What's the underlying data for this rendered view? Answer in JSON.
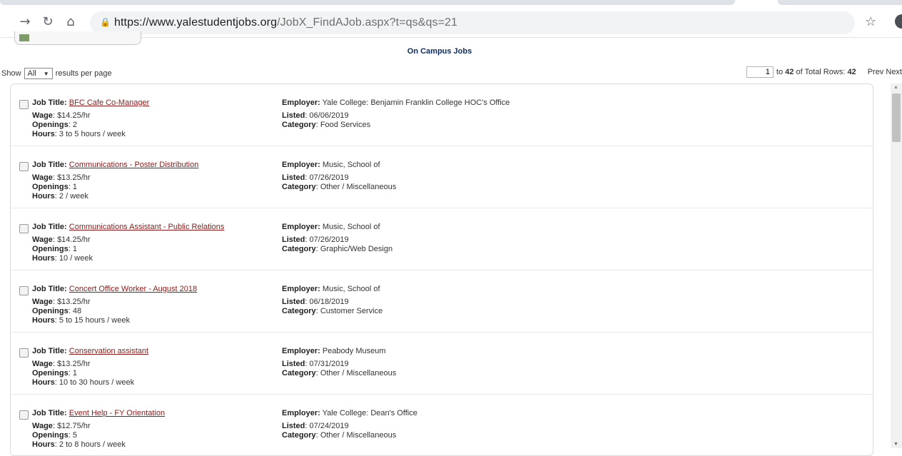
{
  "browser": {
    "url_host": "https://www.yalestudentjobs.org",
    "url_path": "/JobX_FindAJob.aspx?t=qs&qs=21"
  },
  "page": {
    "title": "On Campus Jobs",
    "show_label": "Show",
    "per_page_value": "All",
    "per_page_suffix": "results per page",
    "pager": {
      "current_page": "1",
      "to_label": "to",
      "range_end": "42",
      "of_total_label": "of Total Rows:",
      "total_rows": "42",
      "prev": "Prev",
      "next": "Next"
    }
  },
  "labels": {
    "job_title": "Job Title:",
    "wage": "Wage",
    "openings": "Openings",
    "hours": "Hours",
    "employer": "Employer:",
    "listed": "Listed",
    "category": "Category"
  },
  "jobs": [
    {
      "title": "BFC Cafe Co-Manager",
      "wage": "$14.25/hr",
      "openings": "2",
      "hours": "3 to 5 hours / week",
      "employer": "Yale College: Benjamin Franklin College HOC's Office",
      "listed": "06/06/2019",
      "category": "Food Services"
    },
    {
      "title": "Communications - Poster Distribution",
      "wage": "$13.25/hr",
      "openings": "1",
      "hours": "2 / week",
      "employer": "Music, School of",
      "listed": "07/26/2019",
      "category": "Other / Miscellaneous"
    },
    {
      "title": "Communications Assistant - Public Relations",
      "wage": "$14.25/hr",
      "openings": "1",
      "hours": "10 / week",
      "employer": "Music, School of",
      "listed": "07/26/2019",
      "category": "Graphic/Web Design"
    },
    {
      "title": "Concert Office Worker - August 2018",
      "wage": "$13.25/hr",
      "openings": "48",
      "hours": "5 to 15 hours / week",
      "employer": "Music, School of",
      "listed": "06/18/2019",
      "category": "Customer Service"
    },
    {
      "title": "Conservation assistant",
      "wage": "$13.25/hr",
      "openings": "1",
      "hours": "10 to 30 hours / week",
      "employer": "Peabody Museum",
      "listed": "07/31/2019",
      "category": "Other / Miscellaneous"
    },
    {
      "title": "Event Help - FY Orientation",
      "wage": "$12.75/hr",
      "openings": "5",
      "hours": "2 to 8 hours / week",
      "employer": "Yale College: Dean's Office",
      "listed": "07/24/2019",
      "category": "Other / Miscellaneous"
    }
  ]
}
